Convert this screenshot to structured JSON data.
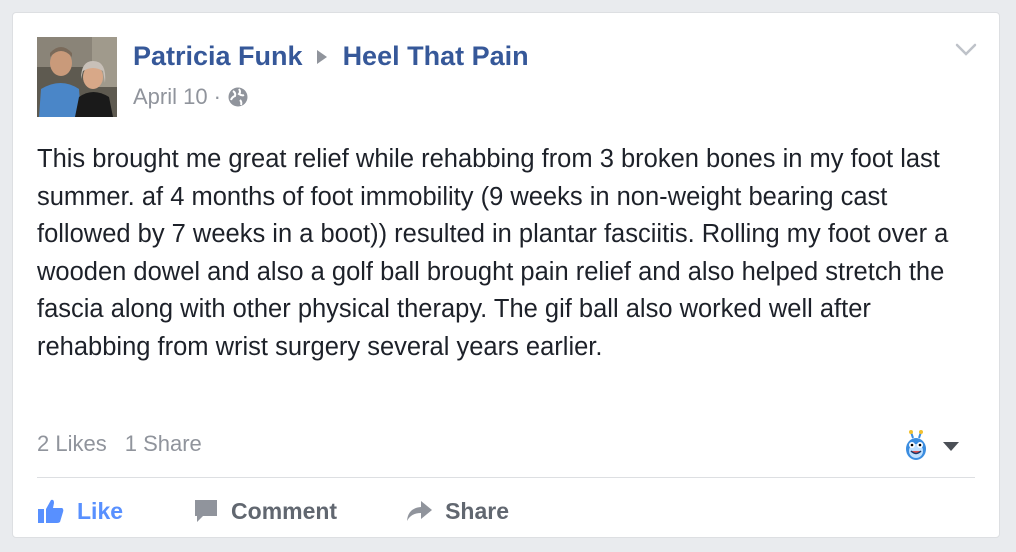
{
  "post": {
    "author": "Patricia Funk",
    "group": "Heel That Pain",
    "date": "April 10",
    "separator": "·",
    "privacy_icon": "globe-icon",
    "text": "This brought me great relief while rehabbing from 3 broken bones in my foot last summer. af 4 months of foot immobility (9 weeks in non-weight bearing cast followed by 7 weeks in a boot)) resulted in plantar fasciitis. Rolling my foot over a wooden dowel and also a golf ball brought pain relief and also helped stretch the fascia along with other physical therapy. The gif ball also worked well after rehabbing from wrist surgery several years earlier."
  },
  "stats": {
    "likes": "2 Likes",
    "shares": "1 Share"
  },
  "actions": {
    "like": "Like",
    "comment": "Comment",
    "share": "Share"
  },
  "colors": {
    "link": "#365899",
    "meta": "#90949c",
    "like_blue": "#5890ff",
    "action_gray": "#616770"
  }
}
